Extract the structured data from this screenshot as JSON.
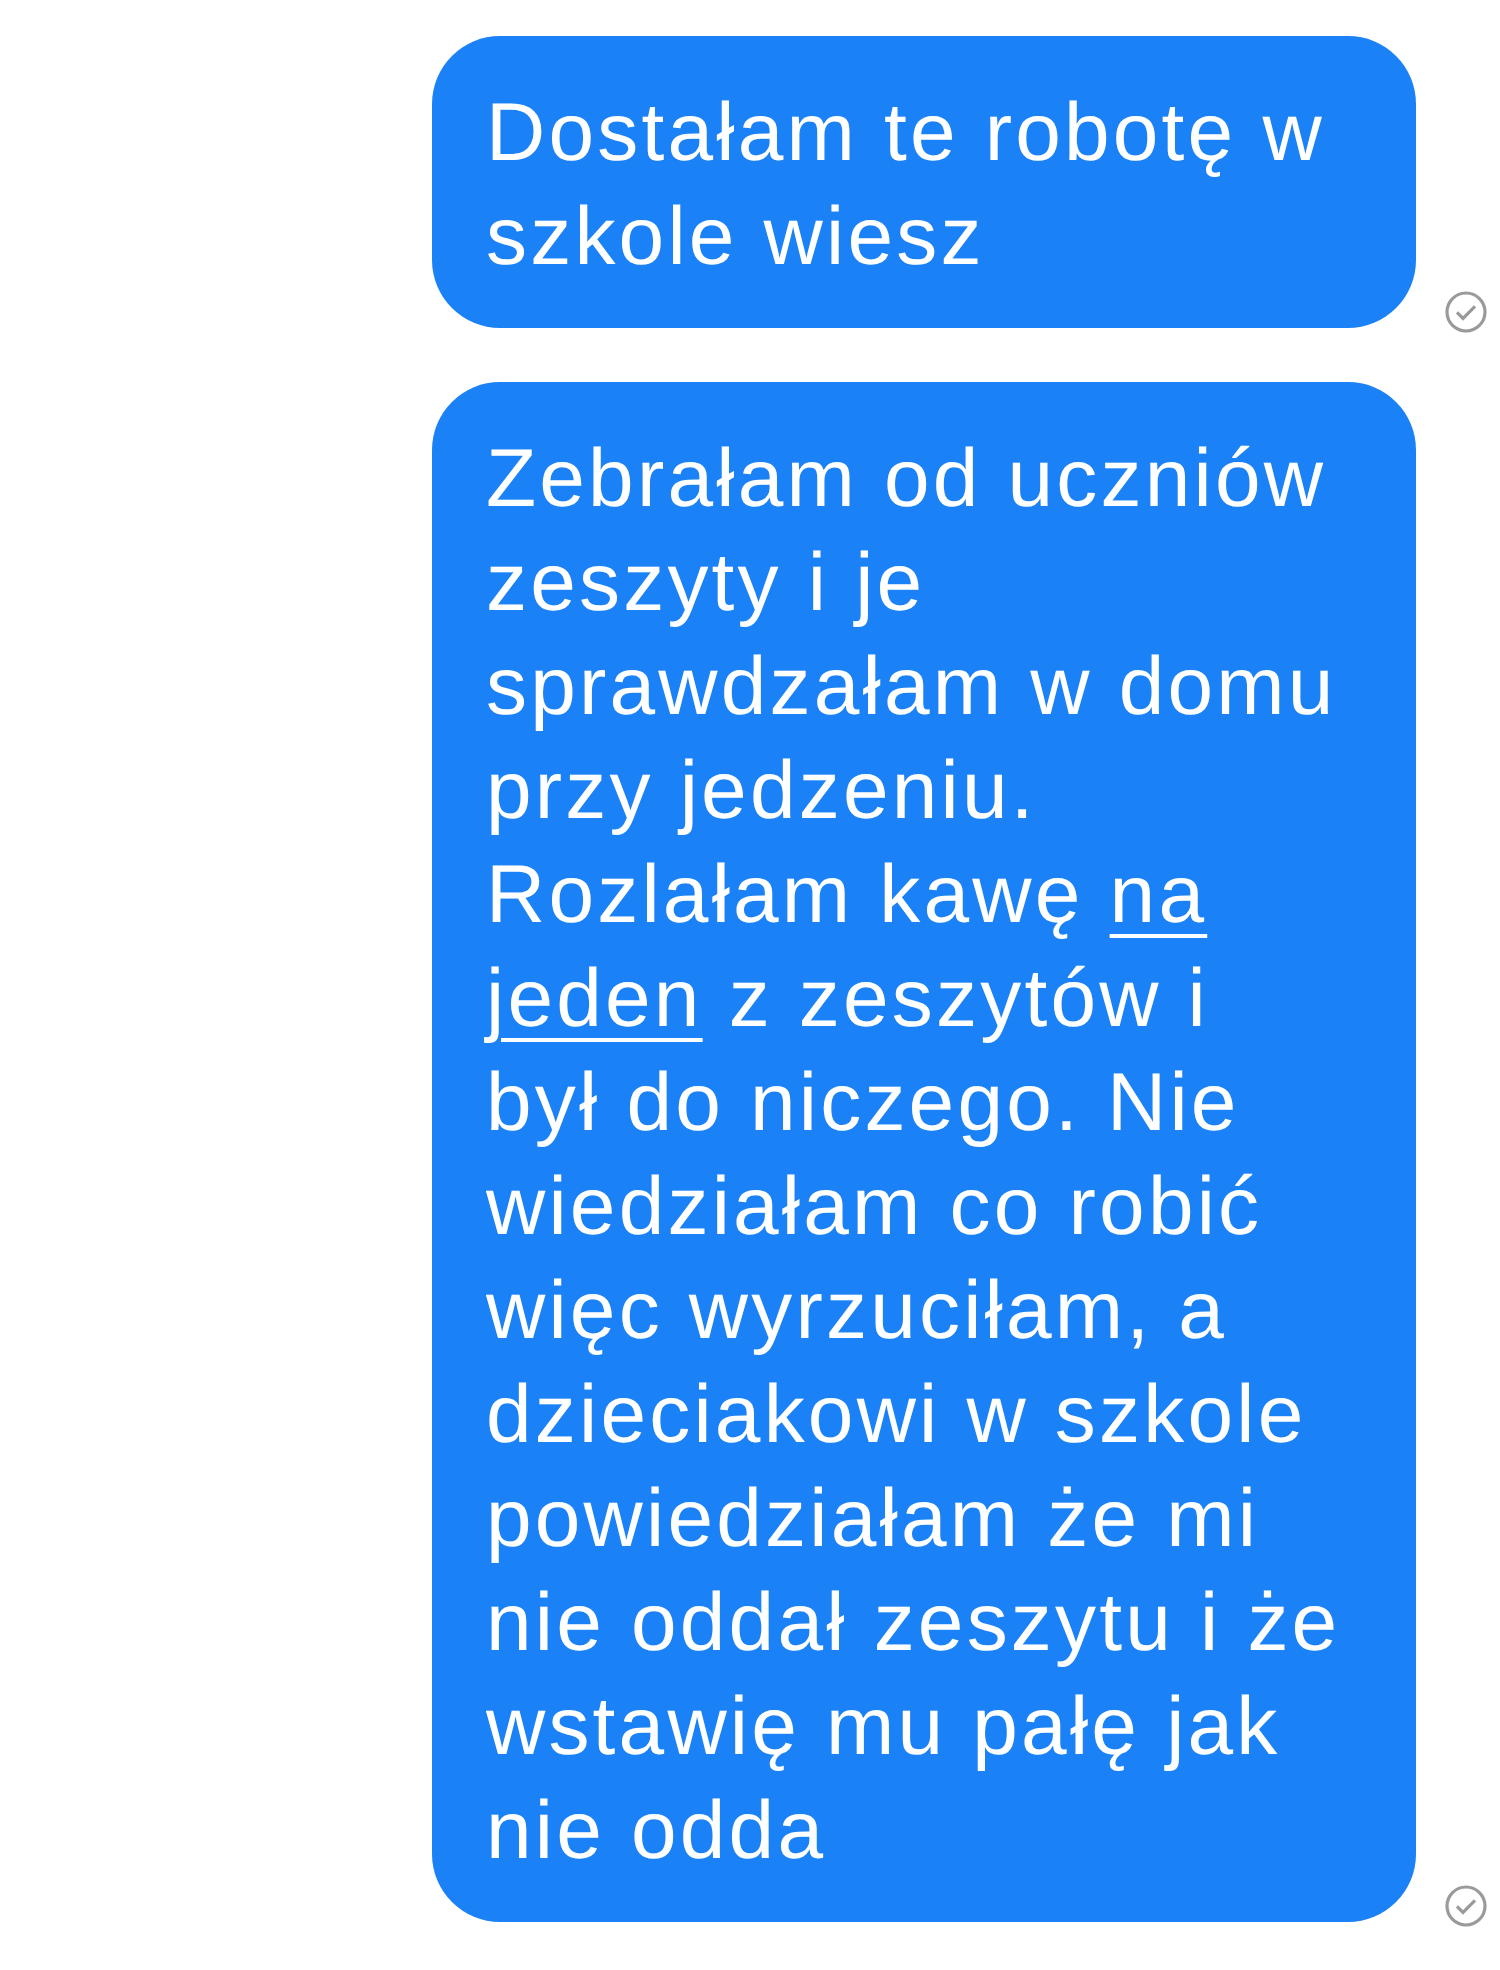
{
  "messages": [
    {
      "delivered": true,
      "segments": [
        {
          "text": "Dostałam te robotę w\nszkole wiesz",
          "underlined": false
        }
      ]
    },
    {
      "delivered": true,
      "segments": [
        {
          "text": "Zebrałam od uczniów\nzeszyty i je\nsprawdzałam w domu\nprzy jedzeniu.\nRozlałam kawę ",
          "underlined": false
        },
        {
          "text": "na\njeden",
          "underlined": true
        },
        {
          "text": " z zeszytów i\nbył do niczego. Nie\nwiedziałam co robić\nwięc wyrzuciłam, a\ndzieciakowi w szkole\npowiedziałam że mi\nnie oddał zeszytu i że\nwstawię mu pałę jak\nnie odda",
          "underlined": false
        }
      ]
    }
  ]
}
